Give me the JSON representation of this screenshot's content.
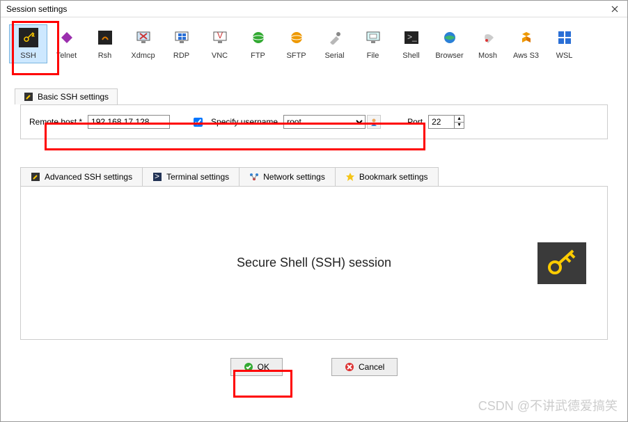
{
  "window": {
    "title": "Session settings"
  },
  "session_types": [
    {
      "id": "ssh",
      "label": "SSH",
      "selected": true
    },
    {
      "id": "telnet",
      "label": "Telnet"
    },
    {
      "id": "rsh",
      "label": "Rsh"
    },
    {
      "id": "xdmcp",
      "label": "Xdmcp"
    },
    {
      "id": "rdp",
      "label": "RDP"
    },
    {
      "id": "vnc",
      "label": "VNC"
    },
    {
      "id": "ftp",
      "label": "FTP"
    },
    {
      "id": "sftp",
      "label": "SFTP"
    },
    {
      "id": "serial",
      "label": "Serial"
    },
    {
      "id": "file",
      "label": "File"
    },
    {
      "id": "shell",
      "label": "Shell"
    },
    {
      "id": "browser",
      "label": "Browser"
    },
    {
      "id": "mosh",
      "label": "Mosh"
    },
    {
      "id": "awss3",
      "label": "Aws S3"
    },
    {
      "id": "wsl",
      "label": "WSL"
    }
  ],
  "basic_tab": {
    "label": "Basic SSH settings"
  },
  "form": {
    "remote_host_label": "Remote host *",
    "remote_host_value": "192.168.17.128",
    "specify_user_label": "Specify username",
    "specify_user_checked": true,
    "username_value": "root",
    "port_label": "Port",
    "port_value": "22"
  },
  "adv_tabs": [
    {
      "id": "adv",
      "label": "Advanced SSH settings",
      "icon": "wrench"
    },
    {
      "id": "term",
      "label": "Terminal settings",
      "icon": "terminal"
    },
    {
      "id": "net",
      "label": "Network settings",
      "icon": "network"
    },
    {
      "id": "bm",
      "label": "Bookmark settings",
      "icon": "star"
    }
  ],
  "panel_title": "Secure Shell (SSH) session",
  "buttons": {
    "ok": "OK",
    "cancel": "Cancel"
  },
  "watermark": "CSDN @不讲武德爱搞笑"
}
